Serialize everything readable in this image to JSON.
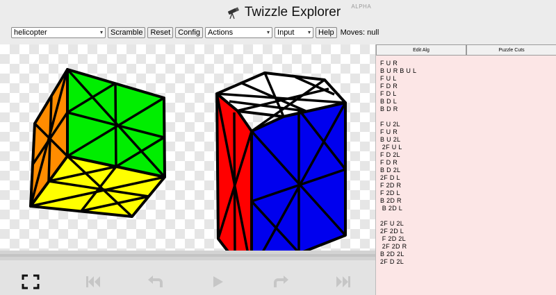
{
  "header": {
    "title": "Twizzle Explorer",
    "badge": "ALPHA",
    "icon": "telescope-icon"
  },
  "toolbar": {
    "puzzle_value": "helicopter",
    "scramble_label": "Scramble",
    "reset_label": "Reset",
    "config_label": "Config",
    "actions_value": "Actions",
    "input_value": "Input",
    "help_label": "Help",
    "moves_text": "Moves: null"
  },
  "side": {
    "tab_edit": "Edit Alg",
    "tab_cuts": "Puzzle Cuts",
    "alg_lines": [
      "F U R",
      "B U R B U L",
      "F U L",
      "F D R",
      "F D L",
      "B D L",
      "B D R",
      "",
      "F U 2L",
      "F U R",
      "B U 2L",
      " 2F U L",
      "F D 2L",
      "F D R",
      "B D 2L",
      "2F D L",
      "F 2D R",
      "F 2D L",
      "B 2D R",
      " B 2D L",
      "",
      "2F U 2L",
      "2F 2D L",
      " F 2D 2L",
      " 2F 2D R",
      "B 2D 2L",
      "2F D 2L"
    ]
  },
  "colors": {
    "green": "#00ee00",
    "yellow": "#ffff00",
    "orange": "#ff8c00",
    "blue": "#0000ee",
    "white": "#ffffff",
    "red": "#ff0000",
    "sidebar_bg": "#fce6e6"
  }
}
